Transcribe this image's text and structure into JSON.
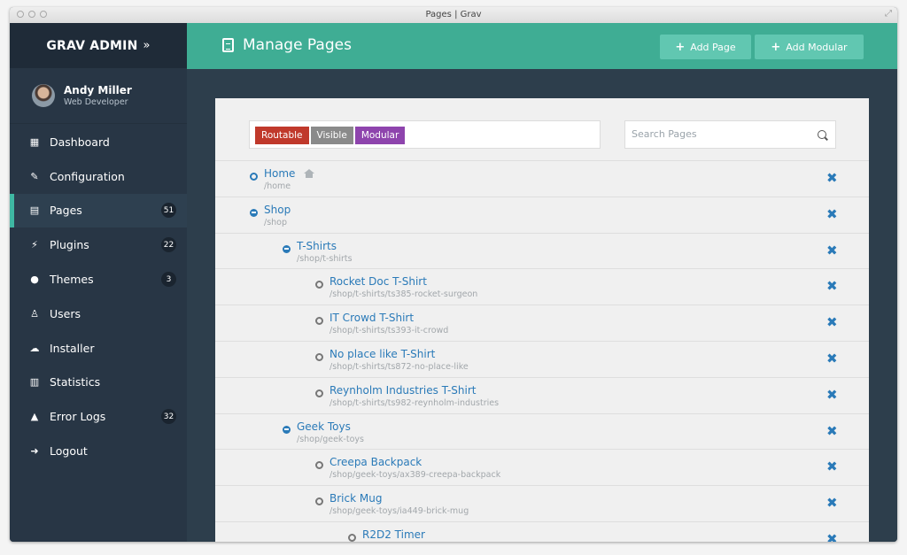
{
  "window": {
    "title": "Pages | Grav"
  },
  "brand": {
    "name": "GRAV ADMIN",
    "arrow": "»"
  },
  "user": {
    "name": "Andy Miller",
    "role": "Web Developer"
  },
  "nav": [
    {
      "label": "Dashboard",
      "icon": "dashboard-icon",
      "badge": ""
    },
    {
      "label": "Configuration",
      "icon": "wrench-icon",
      "badge": ""
    },
    {
      "label": "Pages",
      "icon": "file-icon",
      "badge": "51"
    },
    {
      "label": "Plugins",
      "icon": "plug-icon",
      "badge": "22"
    },
    {
      "label": "Themes",
      "icon": "tint-icon",
      "badge": "3"
    },
    {
      "label": "Users",
      "icon": "male-icon",
      "badge": ""
    },
    {
      "label": "Installer",
      "icon": "cloud-download-icon",
      "badge": ""
    },
    {
      "label": "Statistics",
      "icon": "bar-chart-icon",
      "badge": ""
    },
    {
      "label": "Error Logs",
      "icon": "warning-icon",
      "badge": "32"
    },
    {
      "label": "Logout",
      "icon": "sign-out-icon",
      "badge": ""
    }
  ],
  "header": {
    "title": "Manage Pages",
    "add_page": "Add Page",
    "add_modular": "Add Modular"
  },
  "filters": {
    "tags": [
      {
        "label": "Routable",
        "color": "#c0392b"
      },
      {
        "label": "Visible",
        "color": "#8a8a8a"
      },
      {
        "label": "Modular",
        "color": "#8e44ad"
      }
    ],
    "search_placeholder": "Search Pages"
  },
  "pages": [
    {
      "title": "Home",
      "path": "/home",
      "marker": "open",
      "home": true
    },
    {
      "title": "Shop",
      "path": "/shop",
      "marker": "collapse"
    },
    {
      "title": "T-Shirts",
      "path": "/shop/t-shirts",
      "marker": "collapse"
    },
    {
      "title": "Rocket Doc T-Shirt",
      "path": "/shop/t-shirts/ts385-rocket-surgeon",
      "marker": "leaf"
    },
    {
      "title": "IT Crowd T-Shirt",
      "path": "/shop/t-shirts/ts393-it-crowd",
      "marker": "leaf"
    },
    {
      "title": "No place like T-Shirt",
      "path": "/shop/t-shirts/ts872-no-place-like",
      "marker": "leaf"
    },
    {
      "title": "Reynholm Industries T-Shirt",
      "path": "/shop/t-shirts/ts982-reynholm-industries",
      "marker": "leaf"
    },
    {
      "title": "Geek Toys",
      "path": "/shop/geek-toys",
      "marker": "collapse"
    },
    {
      "title": "Creepa Backpack",
      "path": "/shop/geek-toys/ax389-creepa-backpack",
      "marker": "leaf"
    },
    {
      "title": "Brick Mug",
      "path": "/shop/geek-toys/ia449-brick-mug",
      "marker": "leaf"
    },
    {
      "title": "R2D2 Timer",
      "path": "",
      "marker": "leaf"
    }
  ],
  "delete_symbol": "✖"
}
